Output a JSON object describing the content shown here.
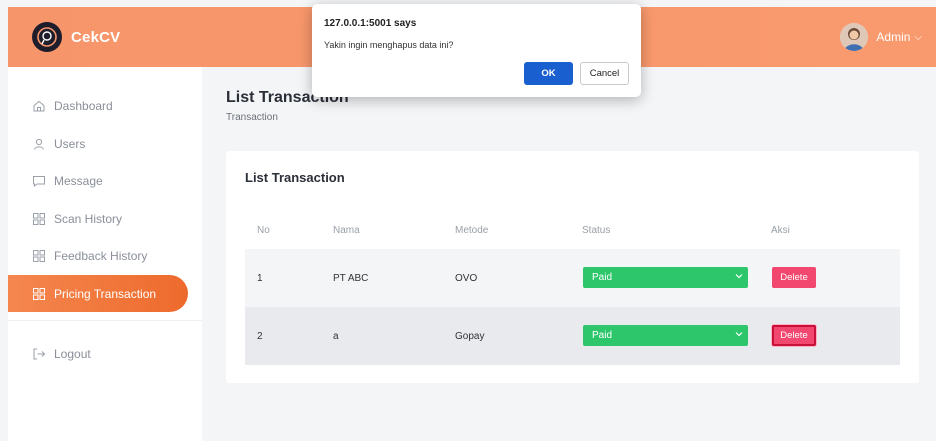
{
  "header": {
    "brand": "CekCV",
    "user_name": "Admin",
    "chevron": "⌵"
  },
  "sidebar": {
    "items": [
      {
        "label": "Dashboard",
        "icon": "home-icon"
      },
      {
        "label": "Users",
        "icon": "user-icon"
      },
      {
        "label": "Message",
        "icon": "message-icon"
      },
      {
        "label": "Scan History",
        "icon": "grid-icon"
      },
      {
        "label": "Feedback History",
        "icon": "grid-icon"
      },
      {
        "label": "Pricing Transaction",
        "icon": "grid-icon",
        "active": true
      },
      {
        "label": "Logout",
        "icon": "logout-icon"
      }
    ]
  },
  "page": {
    "title": "List Transaction",
    "breadcrumb": "Transaction"
  },
  "card": {
    "title": "List Transaction",
    "columns": [
      "No",
      "Nama",
      "Metode",
      "Status",
      "Aksi"
    ],
    "rows": [
      {
        "no": "1",
        "nama": "PT ABC",
        "metode": "OVO",
        "status": "Paid",
        "action": "Delete"
      },
      {
        "no": "2",
        "nama": "a",
        "metode": "Gopay",
        "status": "Paid",
        "action": "Delete"
      }
    ]
  },
  "dialog": {
    "title": "127.0.0.1:5001 says",
    "message": "Yakin ingin menghapus data ini?",
    "ok_label": "OK",
    "cancel_label": "Cancel"
  },
  "colors": {
    "header": "#f7956a",
    "active_nav": "#ee6a2c",
    "status_paid": "#2dc66b",
    "delete": "#f2476e",
    "ok_button": "#1a5fd0"
  }
}
